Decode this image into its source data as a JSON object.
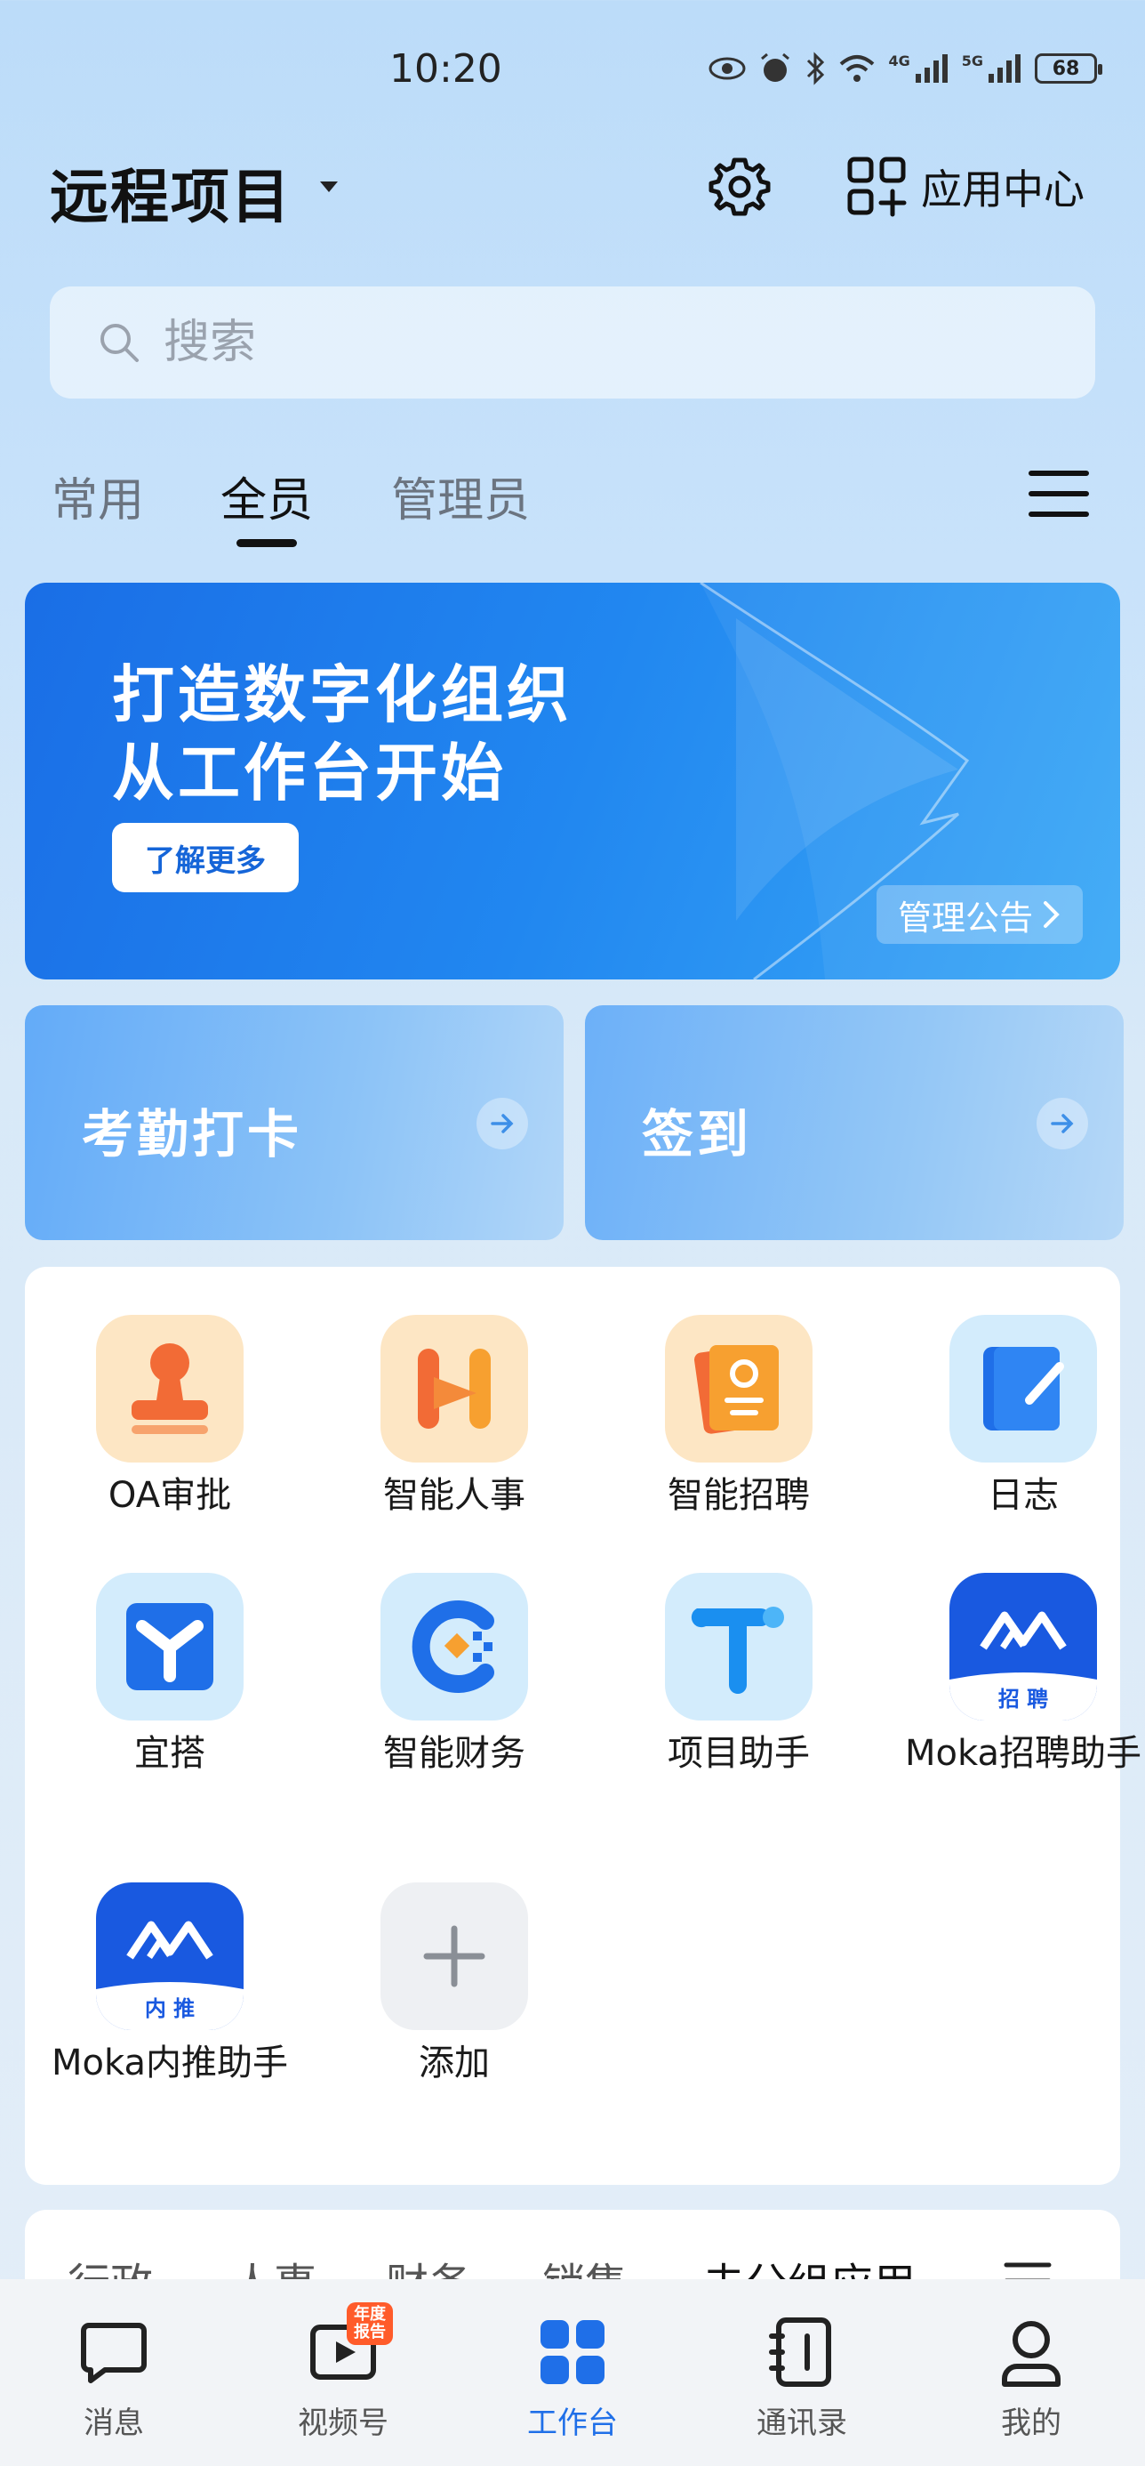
{
  "status_bar": {
    "time": "10:20",
    "net1": "4G",
    "net2": "5G",
    "battery": "68"
  },
  "header": {
    "project_title": "远程项目",
    "app_center_label": "应用中心"
  },
  "search": {
    "placeholder": "搜索"
  },
  "tabs": [
    {
      "label": "常用",
      "active": false
    },
    {
      "label": "全员",
      "active": true
    },
    {
      "label": "管理员",
      "active": false
    }
  ],
  "banner": {
    "title": "打造数字化组织\n从工作台开始",
    "cta": "了解更多",
    "notice": "管理公告"
  },
  "quick_cards": [
    {
      "label": "考勤打卡"
    },
    {
      "label": "签到"
    }
  ],
  "apps": [
    {
      "label": "OA审批",
      "icon": "stamp-icon"
    },
    {
      "label": "智能人事",
      "icon": "hr-icon"
    },
    {
      "label": "智能招聘",
      "icon": "recruit-icon"
    },
    {
      "label": "日志",
      "icon": "log-icon"
    },
    {
      "label": "宜搭",
      "icon": "yida-icon"
    },
    {
      "label": "智能财务",
      "icon": "finance-icon"
    },
    {
      "label": "项目助手",
      "icon": "project-icon"
    },
    {
      "label": "Moka招聘助手",
      "icon": "moka-recruit-icon",
      "badge": "招 聘"
    },
    {
      "label": "Moka内推助手",
      "icon": "moka-referral-icon",
      "badge": "内 推"
    },
    {
      "label": "添加",
      "icon": "add-icon"
    }
  ],
  "categories": [
    "行政",
    "人事",
    "财务",
    "销售",
    "未分组应用"
  ],
  "bottom_nav": [
    {
      "label": "消息",
      "icon": "message-icon",
      "active": false
    },
    {
      "label": "视频号",
      "icon": "video-icon",
      "active": false,
      "badge": "年度报告"
    },
    {
      "label": "工作台",
      "icon": "workbench-icon",
      "active": true
    },
    {
      "label": "通讯录",
      "icon": "contacts-icon",
      "active": false
    },
    {
      "label": "我的",
      "icon": "profile-icon",
      "active": false
    }
  ],
  "colors": {
    "accent": "#1f6fe8",
    "banner": "#1a6ee6",
    "badge": "#ff5b2a"
  }
}
